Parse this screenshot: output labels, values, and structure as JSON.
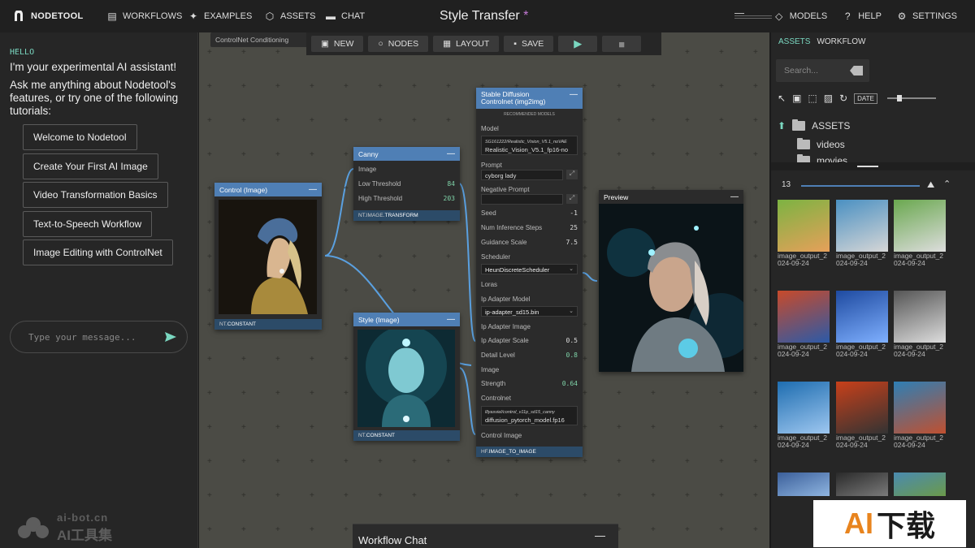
{
  "topbar": {
    "brand": "NODETOOL",
    "nav": [
      "WORKFLOWS",
      "EXAMPLES",
      "ASSETS",
      "CHAT"
    ],
    "title": "Style Transfer",
    "modified_mark": "*",
    "right": [
      "MODELS",
      "HELP",
      "SETTINGS"
    ]
  },
  "chat": {
    "hello": "HELLO",
    "line1": "I'm your experimental AI assistant!",
    "line2": "Ask me anything about Nodetool's features, or try one of the following tutorials:",
    "tutorials": [
      "Welcome to Nodetool",
      "Create Your First AI Image",
      "Video Transformation Basics",
      "Text-to-Speech Workflow",
      "Image Editing with ControlNet"
    ],
    "placeholder": "Type your message..."
  },
  "watermark_left": {
    "top": "ai-bot.cn",
    "bottom": "AI工具集"
  },
  "toolbar": {
    "buttons": [
      "NEW",
      "NODES",
      "LAYOUT",
      "SAVE"
    ],
    "tag": "ControlNet Conditioning"
  },
  "nodes": {
    "control": {
      "title": "Control (Image)",
      "footer_ns": "NT.",
      "footer_type": "CONSTANT"
    },
    "canny": {
      "title": "Canny",
      "image_label": "Image",
      "low_label": "Low Threshold",
      "low_value": "84",
      "high_label": "High Threshold",
      "high_value": "203",
      "footer_ns": "NT.IMAGE.",
      "footer_type": "TRANSFORM"
    },
    "style": {
      "title": "Style (Image)",
      "footer_ns": "NT.",
      "footer_type": "CONSTANT"
    },
    "sd": {
      "title": "Stable Diffusion Controlnet (img2img)",
      "recommended": "RECOMMENDED MODELS",
      "model_label": "Model",
      "model_path": "SG161222/Realistic_Vision_V5.1_noVAE",
      "model_file": "Realistic_Vision_V5.1_fp16-no",
      "prompt_label": "Prompt",
      "prompt_value": "cyborg lady",
      "neg_label": "Negative Prompt",
      "neg_value": "",
      "seed_label": "Seed",
      "seed_value": "-1",
      "steps_label": "Num Inference Steps",
      "steps_value": "25",
      "guidance_label": "Guidance Scale",
      "guidance_value": "7.5",
      "scheduler_label": "Scheduler",
      "scheduler_value": "HeunDiscreteScheduler",
      "loras_label": "Loras",
      "ipmodel_label": "Ip Adapter Model",
      "ipmodel_value": "ip-adapter_sd15.bin",
      "ipimage_label": "Ip Adapter Image",
      "ipscale_label": "Ip Adapter Scale",
      "ipscale_value": "0.5",
      "detail_label": "Detail Level",
      "detail_value": "0.8",
      "image_label": "Image",
      "strength_label": "Strength",
      "strength_value": "0.64",
      "controlnet_label": "Controlnet",
      "controlnet_path": "lllyasviel/control_v11p_sd15_canny",
      "controlnet_file": "diffusion_pytorch_model.fp16",
      "controlimage_label": "Control Image",
      "footer_ns": "HF.",
      "footer_type": "IMAGE_TO_IMAGE"
    },
    "preview": {
      "title": "Preview"
    }
  },
  "workflow_chat": {
    "title": "Workflow Chat"
  },
  "assets": {
    "tabs": [
      "ASSETS",
      "WORKFLOW"
    ],
    "search_placeholder": "Search...",
    "date_label": "DATE",
    "tree": [
      "ASSETS",
      "videos",
      "movies"
    ],
    "count": "13",
    "thumb_label": "image_output_2024-09-24"
  },
  "watermark_right": {
    "a": "AI",
    "b": "下载"
  },
  "colors": {
    "accent": "#7ad7c0",
    "node_header": "#4f7fb5",
    "canvas": "#4b4b45"
  }
}
